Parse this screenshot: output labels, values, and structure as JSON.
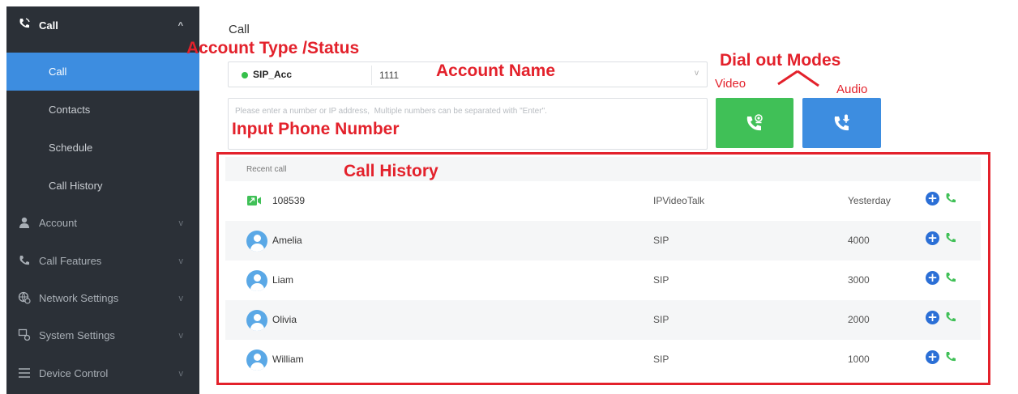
{
  "sidebar": {
    "sections": [
      {
        "label": "Call",
        "icon": "call-video-icon",
        "chevron": "^"
      },
      {
        "label": "Account",
        "icon": "user-icon",
        "chevron": "v"
      },
      {
        "label": "Call Features",
        "icon": "phone-icon",
        "chevron": "v"
      },
      {
        "label": "Network Settings",
        "icon": "network-icon",
        "chevron": "v"
      },
      {
        "label": "System Settings",
        "icon": "system-icon",
        "chevron": "v"
      },
      {
        "label": "Device Control",
        "icon": "list-icon",
        "chevron": "v"
      }
    ],
    "call_sub": [
      {
        "label": "Call",
        "active": true
      },
      {
        "label": "Contacts",
        "active": false
      },
      {
        "label": "Schedule",
        "active": false
      },
      {
        "label": "Call History",
        "active": false
      }
    ]
  },
  "main": {
    "title": "Call",
    "account": {
      "type_status": "SIP_Acc",
      "status_color": "#35c04a",
      "number": "1111",
      "caret": "v"
    },
    "input": {
      "placeholder": "Please enter a number or IP address,  Multiple numbers can be separated with \"Enter\"."
    },
    "buttons": {
      "video_color": "#40c057",
      "audio_color": "#3d8de0"
    },
    "history": {
      "header": "Recent call",
      "rows": [
        {
          "name": "108539",
          "protocol": "IPVideoTalk",
          "value": "Yesterday",
          "kind": "video"
        },
        {
          "name": "Amelia",
          "protocol": "SIP",
          "value": "4000",
          "kind": "contact"
        },
        {
          "name": "Liam",
          "protocol": "SIP",
          "value": "3000",
          "kind": "contact"
        },
        {
          "name": "Olivia",
          "protocol": "SIP",
          "value": "2000",
          "kind": "contact"
        },
        {
          "name": "William",
          "protocol": "SIP",
          "value": "1000",
          "kind": "contact"
        }
      ]
    }
  },
  "annotations": {
    "account_type_status": "Account Type /Status",
    "account_name": "Account Name",
    "dial_out_modes": "Dial out Modes",
    "video": "Video",
    "audio": "Audio",
    "input_phone_number": "Input Phone Number",
    "call_history": "Call History",
    "color": "#e3212b"
  }
}
